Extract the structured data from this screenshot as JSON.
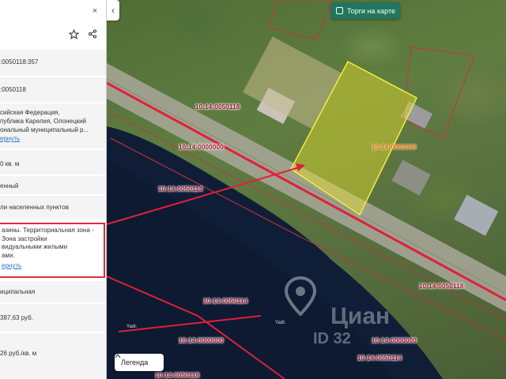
{
  "map": {
    "auction_button": "Торги на карте",
    "legend_button": "Легенда",
    "collapse_glyph": "‹",
    "cadastral_labels": [
      {
        "text": "10:14:0050118",
        "kind": "quarter"
      },
      {
        "text": "10:14:0000000",
        "kind": "quarter"
      },
      {
        "text": "10:14:0050114",
        "kind": "quarter"
      },
      {
        "text": "10:14:0000000",
        "kind": "plot"
      },
      {
        "text": "10:14:0050118",
        "kind": "quarter"
      },
      {
        "text": "10:14:0050114",
        "kind": "quarter"
      },
      {
        "text": "10:14:0000000",
        "kind": "quarter"
      },
      {
        "text": "10:14:0000000",
        "kind": "quarter"
      },
      {
        "text": "10:14:0050114",
        "kind": "quarter"
      },
      {
        "text": "10:14:0050118",
        "kind": "quarter"
      }
    ],
    "place_labels": [
      "Yadr.",
      "Yadr."
    ],
    "watermark": {
      "name": "Циан",
      "id": "ID 32"
    }
  },
  "panel": {
    "close_glyph": "×",
    "icons": {
      "favorite": "star-icon",
      "share": "share-icon"
    },
    "rows": [
      {
        "value": ":0050118:357"
      },
      {
        "value": ":0050118"
      },
      {
        "value": "сийская Федерация,\nпублика Карелия, Олонецкий\nональный муниципальный р...",
        "link": "ернуть"
      },
      {
        "value": "0 кв. м"
      },
      {
        "value": "енный"
      },
      {
        "value": "ли населенных пунктов"
      },
      {
        "value": "азины. Территориальная зона -\nЗона застройки\nвидуальными жилыми\nами.",
        "link": "ернуть"
      },
      {
        "value": "иципальная"
      },
      {
        "value": "387,63 руб."
      },
      {
        "value": "26 руб./кв. м"
      }
    ]
  }
}
